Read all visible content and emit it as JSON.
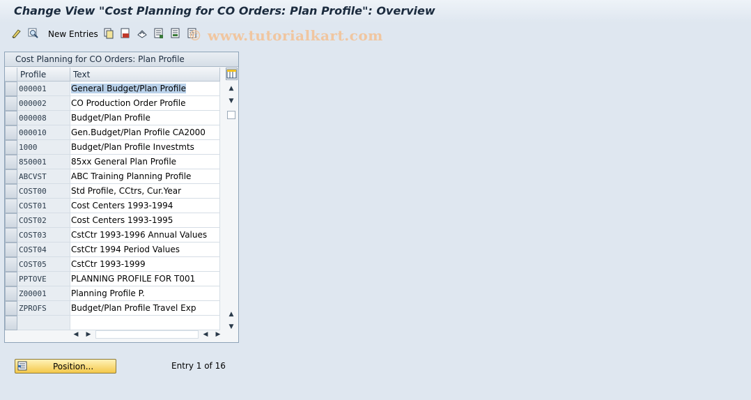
{
  "window": {
    "title": "Change View \"Cost Planning for CO Orders: Plan Profile\": Overview"
  },
  "toolbar": {
    "new_entries_label": "New Entries",
    "icons": [
      "display-change-icon",
      "details-icon",
      "copy-icon",
      "delete-icon",
      "undo-icon",
      "select-all-icon",
      "select-block-icon",
      "deselect-all-icon"
    ],
    "watermark": "© www.tutorialkart.com"
  },
  "panel": {
    "title": "Cost Planning for CO Orders: Plan Profile",
    "columns": {
      "profile": "Profile",
      "text": "Text"
    },
    "rows": [
      {
        "profile": "000001",
        "text": "General Budget/Plan Profile",
        "selected": true
      },
      {
        "profile": "000002",
        "text": "CO Production Order Profile"
      },
      {
        "profile": "000008",
        "text": "Budget/Plan Profile"
      },
      {
        "profile": "000010",
        "text": "Gen.Budget/Plan Profile CA2000"
      },
      {
        "profile": "1000",
        "text": "Budget/Plan Profile Investmts"
      },
      {
        "profile": "850001",
        "text": "85xx General Plan Profile"
      },
      {
        "profile": "ABCVST",
        "text": "ABC Training Planning Profile"
      },
      {
        "profile": "COST00",
        "text": "Std Profile, CCtrs, Cur.Year"
      },
      {
        "profile": "COST01",
        "text": "Cost Centers 1993-1994"
      },
      {
        "profile": "COST02",
        "text": "Cost Centers 1993-1995"
      },
      {
        "profile": "COST03",
        "text": "CstCtr 1993-1996 Annual Values"
      },
      {
        "profile": "COST04",
        "text": "CstCtr 1994 Period Values"
      },
      {
        "profile": "COST05",
        "text": "CstCtr 1993-1999"
      },
      {
        "profile": "PPTOVE",
        "text": "PLANNING PROFILE FOR T001"
      },
      {
        "profile": "Z00001",
        "text": "Planning Profile P."
      },
      {
        "profile": "ZPROFS",
        "text": "Budget/Plan Profile Travel Exp"
      },
      {
        "profile": "",
        "text": ""
      }
    ]
  },
  "footer": {
    "position_label": "Position...",
    "entry_text": "Entry 1 of 16"
  },
  "colors": {
    "selection": "#b9d1ea",
    "button": "#f4c84a",
    "background": "#dfe7f0"
  }
}
